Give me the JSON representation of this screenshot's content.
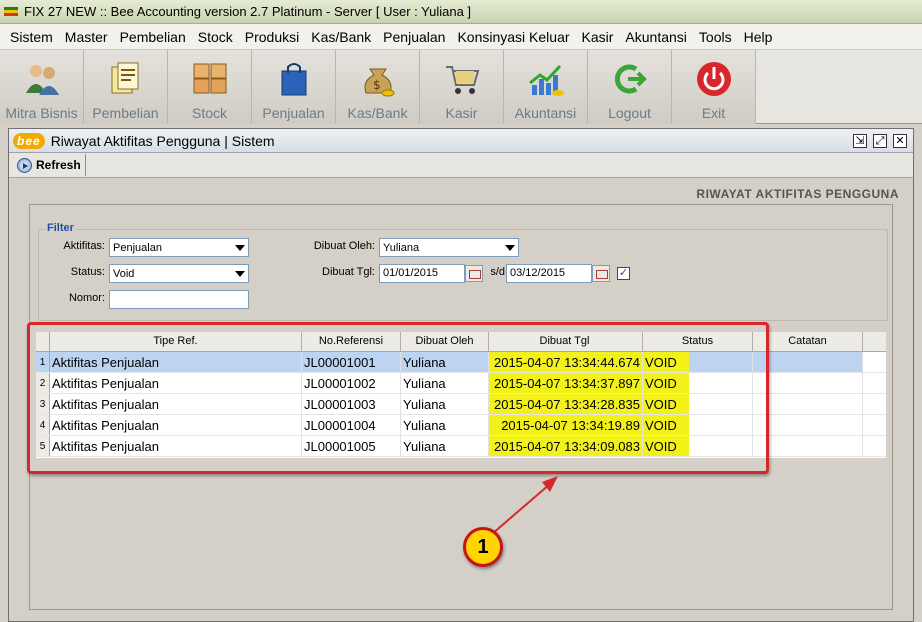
{
  "window": {
    "title": "FIX 27 NEW :: Bee Accounting version 2.7 Platinum - Server  [ User : Yuliana ]",
    "app_icon_colors": [
      "#2b7a2b",
      "#f2c200",
      "#c83a2a"
    ]
  },
  "menu": [
    "Sistem",
    "Master",
    "Pembelian",
    "Stock",
    "Produksi",
    "Kas/Bank",
    "Penjualan",
    "Konsinyasi Keluar",
    "Kasir",
    "Akuntansi",
    "Tools",
    "Help"
  ],
  "toolbar": [
    {
      "label": "Mitra Bisnis",
      "icon": "people-icon"
    },
    {
      "label": "Pembelian",
      "icon": "documents-icon"
    },
    {
      "label": "Stock",
      "icon": "boxes-icon"
    },
    {
      "label": "Penjualan",
      "icon": "shopping-bag-icon"
    },
    {
      "label": "Kas/Bank",
      "icon": "money-bag-icon"
    },
    {
      "label": "Kasir",
      "icon": "cart-icon"
    },
    {
      "label": "Akuntansi",
      "icon": "chart-growth-icon"
    },
    {
      "label": "Logout",
      "icon": "logout-icon"
    },
    {
      "label": "Exit",
      "icon": "power-icon"
    }
  ],
  "child_window": {
    "logo": "bee",
    "title": "Riwayat Aktifitas Pengguna | Sistem",
    "refresh_label": "Refresh",
    "heading": "RIWAYAT AKTIFITAS PENGGUNA"
  },
  "filter": {
    "legend": "Filter",
    "aktifitas_label": "Aktifitas:",
    "aktifitas_value": "Penjualan",
    "status_label": "Status:",
    "status_value": "Void",
    "nomor_label": "Nomor:",
    "nomor_value": "",
    "dibuat_oleh_label": "Dibuat Oleh:",
    "dibuat_oleh_value": "Yuliana",
    "dibuat_tgl_label": "Dibuat Tgl:",
    "date_from": "01/01/2015",
    "sd_label": "s/d",
    "date_to": "03/12/2015",
    "date_checked": true,
    "check_mark": "✓"
  },
  "grid": {
    "columns": [
      "Tipe Ref.",
      "No.Referensi",
      "Dibuat Oleh",
      "Dibuat Tgl",
      "Status",
      "Catatan"
    ],
    "rows": [
      {
        "num": "1",
        "tipe": "Aktifitas Penjualan",
        "no": "JL00001001",
        "oleh": "Yuliana",
        "tgl": "2015-04-07 13:34:44.674",
        "status": "VOID",
        "catatan": ""
      },
      {
        "num": "2",
        "tipe": "Aktifitas Penjualan",
        "no": "JL00001002",
        "oleh": "Yuliana",
        "tgl": "2015-04-07 13:34:37.897",
        "status": "VOID",
        "catatan": ""
      },
      {
        "num": "3",
        "tipe": "Aktifitas Penjualan",
        "no": "JL00001003",
        "oleh": "Yuliana",
        "tgl": "2015-04-07 13:34:28.835",
        "status": "VOID",
        "catatan": ""
      },
      {
        "num": "4",
        "tipe": "Aktifitas Penjualan",
        "no": "JL00001004",
        "oleh": "Yuliana",
        "tgl": "2015-04-07 13:34:19.89",
        "status": "VOID",
        "catatan": ""
      },
      {
        "num": "5",
        "tipe": "Aktifitas Penjualan",
        "no": "JL00001005",
        "oleh": "Yuliana",
        "tgl": "2015-04-07 13:34:09.083",
        "status": "VOID",
        "catatan": ""
      }
    ]
  },
  "annotation": {
    "badge": "1",
    "colors": {
      "rect": "#d9262d",
      "badge_fill": "#ffd400",
      "highlight": "#f2f21a"
    }
  }
}
